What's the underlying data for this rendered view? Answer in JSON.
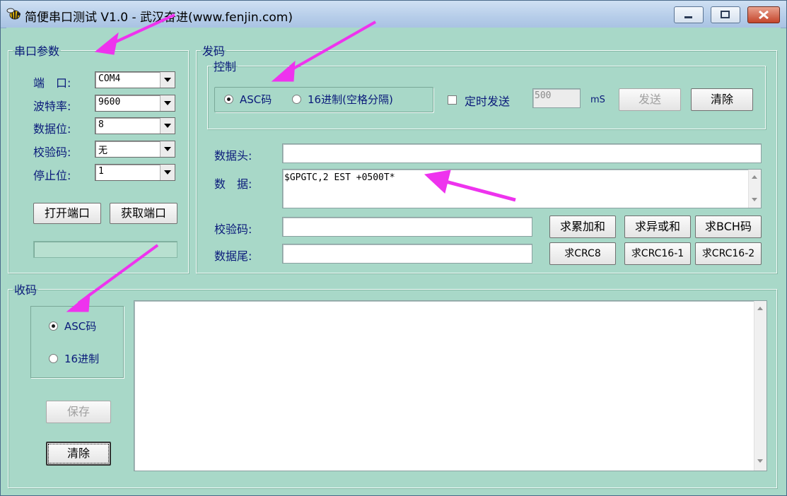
{
  "window": {
    "title": "简便串口测试 V1.0 - 武汉奋进(www.fenjin.com)"
  },
  "serial_params": {
    "legend": "串口参数",
    "port_label": "端　口:",
    "port_value": "COM4",
    "baud_label": "波特率:",
    "baud_value": "9600",
    "databits_label": "数据位:",
    "databits_value": "8",
    "parity_label": "校验码:",
    "parity_value": "无",
    "stopbits_label": "停止位:",
    "stopbits_value": "1",
    "open_button": "打开端口",
    "get_button": "获取端口"
  },
  "send": {
    "legend": "发码",
    "control": {
      "legend": "控制",
      "asc_label": "ASC码",
      "hex_label": "16进制(空格分隔)",
      "timer_label": "定时发送",
      "interval_value": "500",
      "unit": "mS",
      "send_button": "发送",
      "clear_button": "清除"
    },
    "header_label": "数据头:",
    "header_value": "",
    "data_label": "数　据:",
    "data_value": "$GPGTC,2  EST +0500T*",
    "checksum_label": "校验码:",
    "checksum_value": "",
    "tail_label": "数据尾:",
    "tail_value": "",
    "buttons": {
      "sum": "求累加和",
      "xor": "求异或和",
      "bch": "求BCH码",
      "crc8": "求CRC8",
      "crc16_1": "求CRC16-1",
      "crc16_2": "求CRC16-2"
    }
  },
  "receive": {
    "legend": "收码",
    "asc_label": "ASC码",
    "hex_label": "16进制",
    "save_button": "保存",
    "clear_button": "清除",
    "content": ""
  },
  "colors": {
    "panel_bg": "#a8d8c8",
    "label_text": "#0a1a7a",
    "annotation_arrow": "#ee33ee"
  },
  "icons": {
    "app": "bee-icon",
    "minimize": "minimize-icon",
    "maximize": "maximize-icon",
    "close": "close-icon"
  }
}
